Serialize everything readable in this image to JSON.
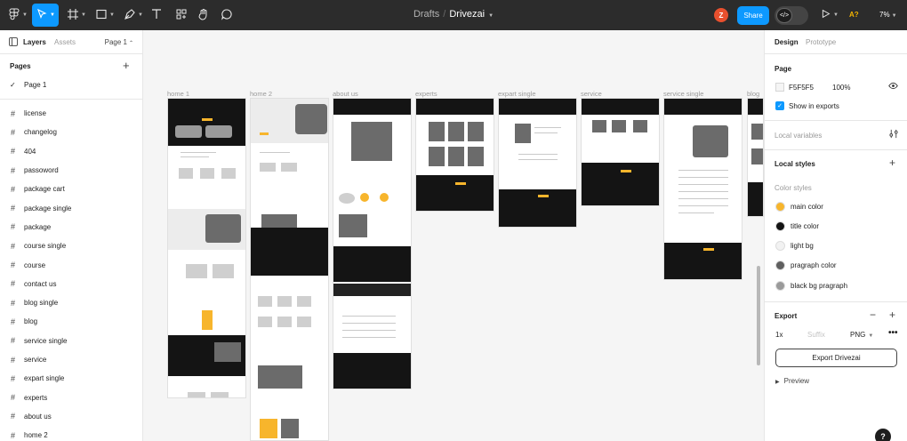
{
  "toolbar": {
    "breadcrumb_parent": "Drafts",
    "separator": "/",
    "file_name": "Drivezai",
    "avatar_initial": "Z",
    "share_label": "Share",
    "accessibility_badge": "A?",
    "zoom": "7%",
    "tools": [
      "main-menu-icon",
      "move-tool-icon",
      "frame-tool-icon",
      "shape-tool-icon",
      "pen-tool-icon",
      "text-tool-icon",
      "resources-icon",
      "hand-tool-icon",
      "comment-tool-icon"
    ]
  },
  "left_panel": {
    "tabs": [
      "Layers",
      "Assets"
    ],
    "page_selector": "Page 1",
    "pages_heading": "Pages",
    "current_page": "Page 1",
    "layers": [
      "license",
      "changelog",
      "404",
      "passoword",
      "package cart",
      "package single",
      "package",
      "course single",
      "course",
      "contact us",
      "blog single",
      "blog",
      "service single",
      "service",
      "expart single",
      "experts",
      "about us",
      "home 2"
    ]
  },
  "canvas": {
    "background": "#F5F5F5",
    "frames": [
      "home 1",
      "home 2",
      "about us",
      "experts",
      "expart single",
      "service",
      "service single",
      "blog"
    ]
  },
  "right_panel": {
    "tabs": [
      "Design",
      "Prototype"
    ],
    "page_heading": "Page",
    "page_color": "F5F5F5",
    "page_opacity": "100%",
    "show_in_exports": "Show in exports",
    "local_variables": "Local variables",
    "local_styles": "Local styles",
    "color_styles_heading": "Color styles",
    "color_styles": [
      {
        "name": "main color",
        "color": "#F7B52C"
      },
      {
        "name": "title color",
        "color": "#141414"
      },
      {
        "name": "light bg",
        "color": "#F2F2F2"
      },
      {
        "name": "pragraph color",
        "color": "#5F5F5F"
      },
      {
        "name": "black bg pragraph",
        "color": "#9A9A9A"
      }
    ],
    "export_heading": "Export",
    "export_scale": "1x",
    "export_suffix_placeholder": "Suffix",
    "export_format": "PNG",
    "export_button": "Export Drivezai",
    "preview": "Preview"
  },
  "help_label": "?"
}
